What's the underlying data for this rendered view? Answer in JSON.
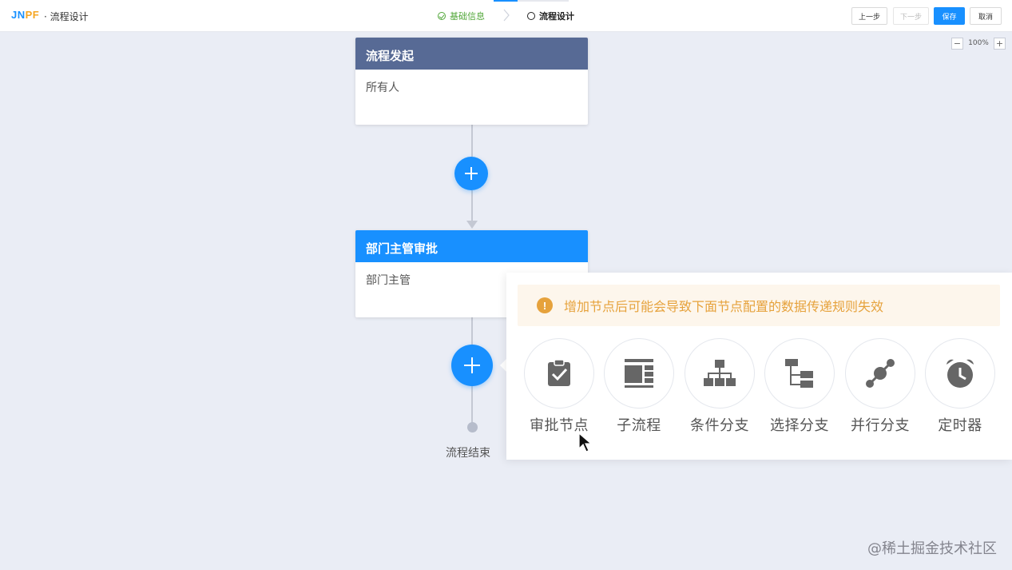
{
  "header": {
    "logo_part1": "JN",
    "logo_part2": "PF",
    "app_title": "· 流程设计",
    "steps": [
      {
        "label": "基础信息",
        "state": "done"
      },
      {
        "label": "流程设计",
        "state": "active"
      }
    ],
    "buttons": {
      "prev": "上一步",
      "next": "下一步",
      "save": "保存",
      "cancel": "取消"
    }
  },
  "zoom": {
    "minus": "−",
    "value": "100%",
    "plus": "+"
  },
  "nodes": [
    {
      "title": "流程发起",
      "content": "所有人",
      "color": "#576a95"
    },
    {
      "title": "部门主管审批",
      "content": "部门主管",
      "color": "#1890ff"
    }
  ],
  "end_label": "流程结束",
  "popover": {
    "warning_icon": "!",
    "warning": "增加节点后可能会导致下面节点配置的数据传递规则失效",
    "options": [
      {
        "label": "审批节点",
        "icon": "clipboard-check-icon"
      },
      {
        "label": "子流程",
        "icon": "subprocess-icon"
      },
      {
        "label": "条件分支",
        "icon": "sitemap-icon"
      },
      {
        "label": "选择分支",
        "icon": "tree-branch-icon"
      },
      {
        "label": "并行分支",
        "icon": "parallel-nodes-icon"
      },
      {
        "label": "定时器",
        "icon": "alarm-clock-icon"
      }
    ]
  },
  "watermark": "@稀土掘金技术社区",
  "colors": {
    "primary": "#1890ff",
    "start_node": "#576a95",
    "warning": "#e6a23c",
    "done_step": "#52a73a",
    "canvas_bg": "#eaedf5"
  }
}
